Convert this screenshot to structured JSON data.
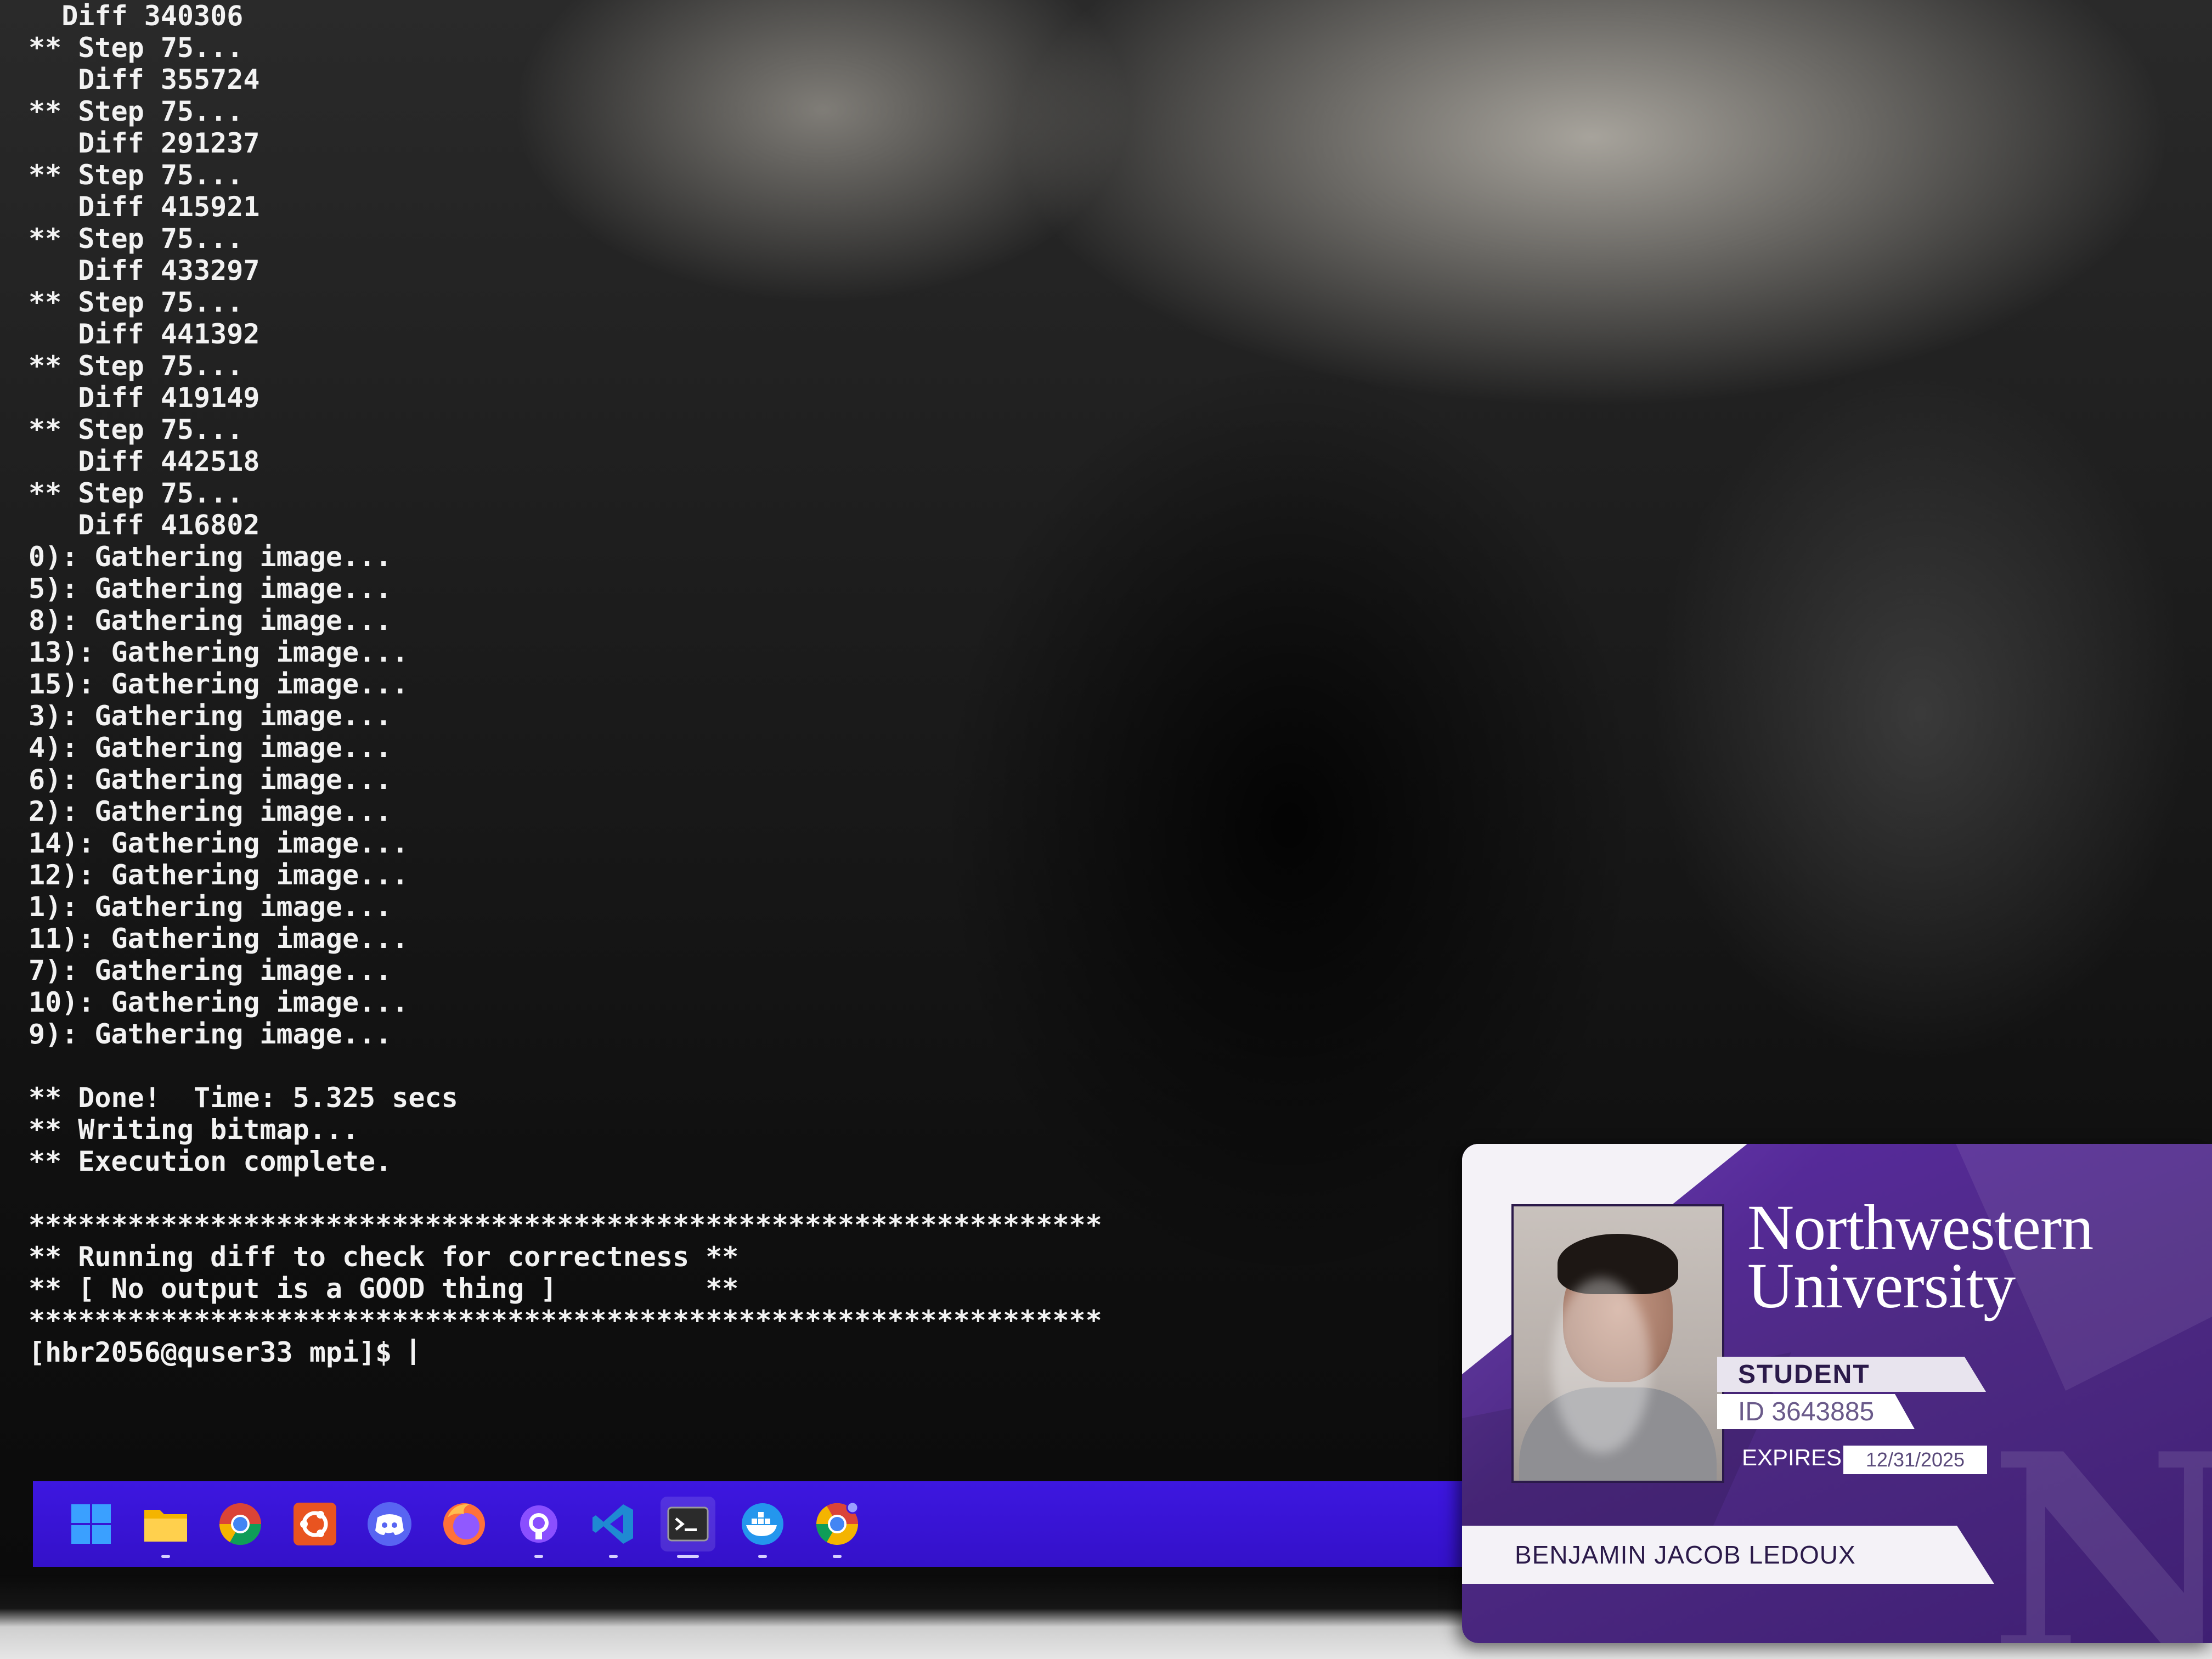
{
  "terminal": {
    "lines": [
      "  Diff 340306",
      "** Step 75...",
      "   Diff 355724",
      "** Step 75...",
      "   Diff 291237",
      "** Step 75...",
      "   Diff 415921",
      "** Step 75...",
      "   Diff 433297",
      "** Step 75...",
      "   Diff 441392",
      "** Step 75...",
      "   Diff 419149",
      "** Step 75...",
      "   Diff 442518",
      "** Step 75...",
      "   Diff 416802",
      "0): Gathering image...",
      "5): Gathering image...",
      "8): Gathering image...",
      "13): Gathering image...",
      "15): Gathering image...",
      "3): Gathering image...",
      "4): Gathering image...",
      "6): Gathering image...",
      "2): Gathering image...",
      "14): Gathering image...",
      "12): Gathering image...",
      "1): Gathering image...",
      "11): Gathering image...",
      "7): Gathering image...",
      "10): Gathering image...",
      "9): Gathering image...",
      "",
      "** Done!  Time: 5.325 secs",
      "** Writing bitmap...",
      "** Execution complete.",
      "",
      "*****************************************************************",
      "** Running diff to check for correctness **",
      "** [ No output is a GOOD thing ]         **",
      "*****************************************************************"
    ],
    "prompt": "[hbr2056@quser33 mpi]$ "
  },
  "taskbar": {
    "items": [
      {
        "name": "windows-start-icon",
        "active": false,
        "running": false
      },
      {
        "name": "file-explorer-icon",
        "active": false,
        "running": true
      },
      {
        "name": "chrome-icon",
        "active": false,
        "running": false
      },
      {
        "name": "ubuntu-icon",
        "active": false,
        "running": false
      },
      {
        "name": "discord-icon",
        "active": false,
        "running": false
      },
      {
        "name": "firefox-icon",
        "active": false,
        "running": false
      },
      {
        "name": "github-desktop-icon",
        "active": false,
        "running": true
      },
      {
        "name": "vscode-icon",
        "active": false,
        "running": true
      },
      {
        "name": "terminal-icon",
        "active": true,
        "running": true
      },
      {
        "name": "docker-icon",
        "active": false,
        "running": true
      },
      {
        "name": "chrome-canary-icon",
        "active": false,
        "running": true
      }
    ],
    "colors": {
      "bar": "#3d17e0"
    }
  },
  "id_card": {
    "university": "Northwestern University",
    "role": "STUDENT",
    "id_text": "ID 3643885",
    "expires_label": "EXPIRES",
    "expires_value": "12/31/2025",
    "holder_name": "BENJAMIN JACOB LEDOUX",
    "watermark": "N",
    "colors": {
      "purple": "#4e2a84",
      "accent": "#e8e4ee"
    }
  }
}
